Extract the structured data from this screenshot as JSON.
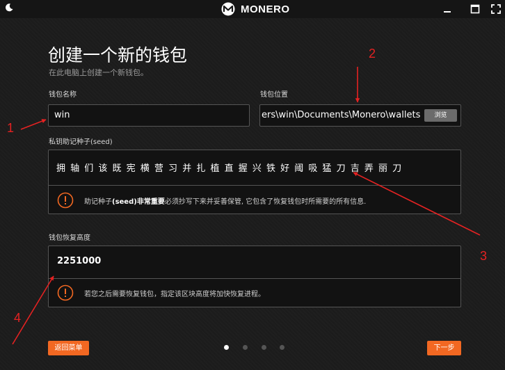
{
  "titlebar": {
    "app_name": "MONERO"
  },
  "page": {
    "title": "创建一个新的钱包",
    "subtitle": "在此电脑上创建一个新钱包。"
  },
  "wallet_name": {
    "label": "钱包名称",
    "value": "win"
  },
  "wallet_location": {
    "label": "钱包位置",
    "value": "ers\\win\\Documents\\Monero\\wallets",
    "browse_label": "浏览"
  },
  "seed": {
    "label": "私钥助记种子(seed)",
    "words": "拥 轴 们 该 既 宪 横 营 习 并 扎 植 直 握 兴 铁 好 阈 吸 猛 刀 吉 弄 丽 刀",
    "warning_prefix": "助记种子",
    "warning_bold": "(seed)非常重要",
    "warning_rest": "必须抄写下来并妥善保管, 它包含了恢复钱包时所需要的所有信息."
  },
  "restore_height": {
    "label": "钱包恢复高度",
    "value": "2251000",
    "warning": "若您之后需要恢复钱包，指定该区块高度将加快恢复进程。"
  },
  "footer": {
    "back_label": "返回菜单",
    "next_label": "下一步",
    "page_index": 1,
    "page_count": 4
  },
  "annotations": [
    "1",
    "2",
    "3",
    "4"
  ],
  "colors": {
    "accent": "#f26822",
    "annotation": "#e52222",
    "background": "#1c1c1c"
  }
}
